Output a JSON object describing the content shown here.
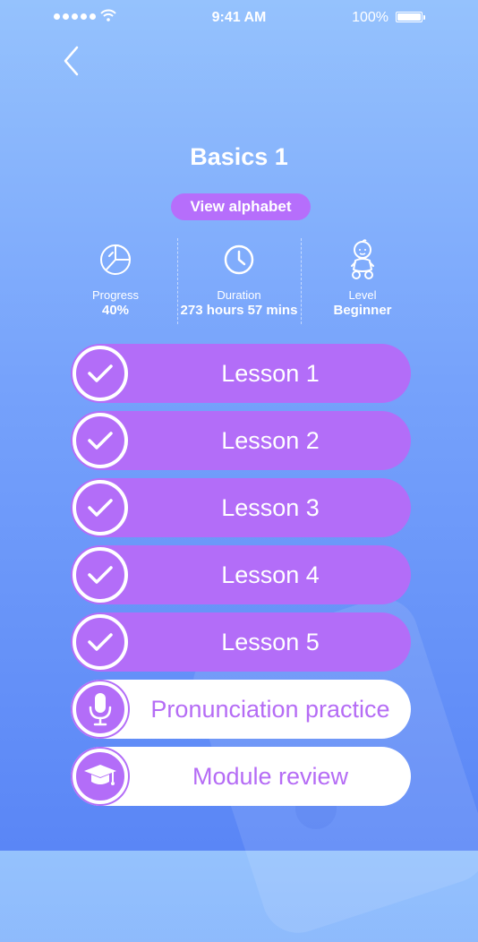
{
  "status_bar": {
    "time": "9:41 AM",
    "battery": "100%"
  },
  "header": {
    "title": "Basics 1",
    "alphabet_button": "View alphabet"
  },
  "stats": [
    {
      "label": "Progress",
      "value": "40%",
      "icon": "pie-chart-icon"
    },
    {
      "label": "Duration",
      "value": "273 hours 57 mins",
      "icon": "clock-icon"
    },
    {
      "label": "Level",
      "value": "Beginner",
      "icon": "baby-icon"
    }
  ],
  "lessons": [
    {
      "label": "Lesson 1",
      "completed": true,
      "icon": "check-icon"
    },
    {
      "label": "Lesson 2",
      "completed": true,
      "icon": "check-icon"
    },
    {
      "label": "Lesson 3",
      "completed": true,
      "icon": "check-icon"
    },
    {
      "label": "Lesson 4",
      "completed": true,
      "icon": "check-icon"
    },
    {
      "label": "Lesson 5",
      "completed": true,
      "icon": "check-icon"
    },
    {
      "label": "Pronunciation practice",
      "completed": false,
      "icon": "microphone-icon"
    },
    {
      "label": "Module review",
      "completed": false,
      "icon": "graduation-cap-icon"
    }
  ],
  "colors": {
    "accent": "#b36df8",
    "bg_top": "#95c2fd",
    "bg_bottom": "#5a86f6"
  }
}
